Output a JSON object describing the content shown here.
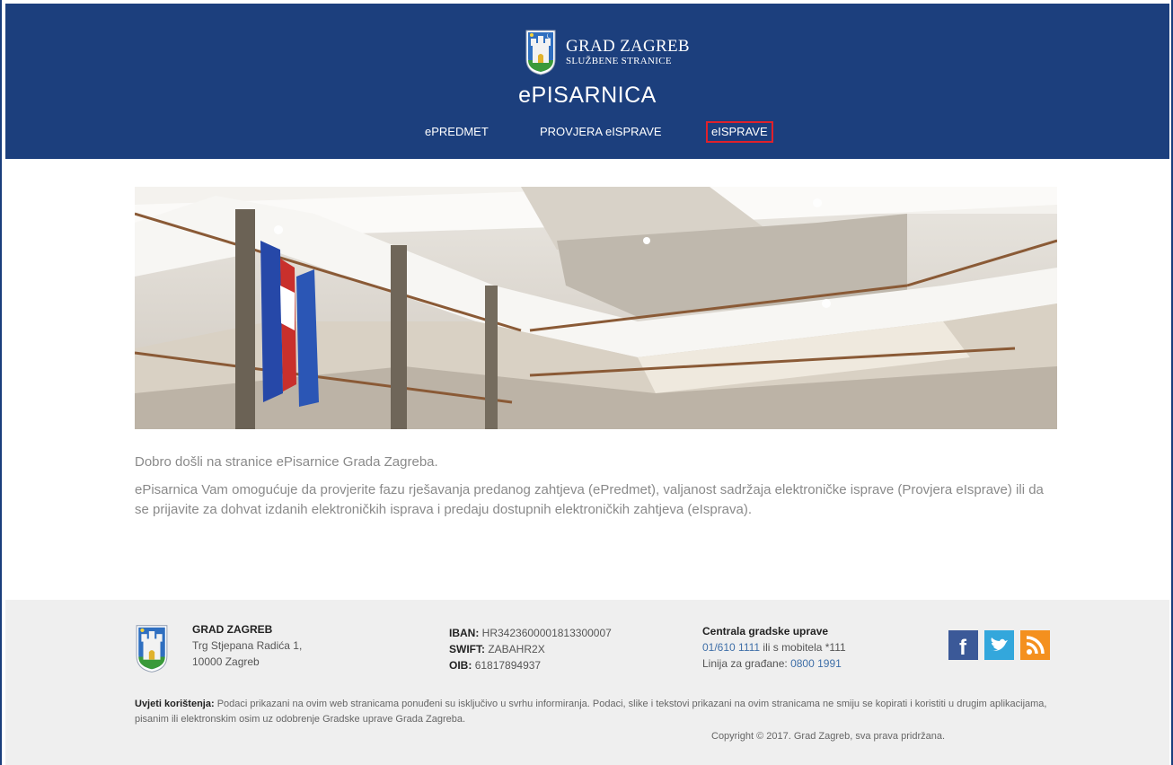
{
  "header": {
    "brand_name": "GRAD ZAGREB",
    "brand_subtitle": "SLUŽBENE STRANICE",
    "app_title": "ePISARNICA",
    "nav": [
      {
        "label": "ePREDMET",
        "active": false
      },
      {
        "label": "PROVJERA eISPRAVE",
        "active": false
      },
      {
        "label": "eISPRAVE",
        "active": true
      }
    ]
  },
  "intro": {
    "welcome": "Dobro došli na stranice ePisarnice Grada Zagreba.",
    "description": "ePisarnica Vam omogućuje da provjerite fazu rješavanja predanog zahtjeva (ePredmet), valjanost sadržaja elektroničke isprave (Provjera eIsprave) ili da se prijavite za dohvat izdanih elektroničkih isprava i predaju dostupnih elektroničkih zahtjeva (eIsprava)."
  },
  "footer": {
    "org_name": "GRAD ZAGREB",
    "address_line1": "Trg Stjepana Radića 1,",
    "address_line2": "10000 Zagreb",
    "iban_label": "IBAN:",
    "iban": "HR3423600001813300007",
    "swift_label": "SWIFT:",
    "swift": "ZABAHR2X",
    "oib_label": "OIB:",
    "oib": "61817894937",
    "central_title": "Centrala gradske uprave",
    "central_phone": "01/610 1111",
    "central_phone_suffix": " ili s mobitela *111",
    "citizens_label": "Linija za građane: ",
    "citizens_phone": "0800 1991",
    "social": [
      "facebook-icon",
      "twitter-icon",
      "rss-icon"
    ],
    "terms_label": "Uvjeti korištenja:",
    "terms_text": " Podaci prikazani na ovim web stranicama ponuđeni su isključivo u svrhu informiranja. Podaci, slike i tekstovi prikazani na ovim stranicama ne smiju se kopirati i koristiti u drugim aplikacijama, pisanim ili elektronskim osim uz odobrenje Gradske uprave Grada Zagreba.",
    "copyright": "Copyright © 2017. Grad Zagreb, sva prava pridržana."
  },
  "colors": {
    "header_bg": "#1c3f7d",
    "active_outline": "#e0212b",
    "footer_bg": "#efefef",
    "link": "#3f6fa8"
  }
}
